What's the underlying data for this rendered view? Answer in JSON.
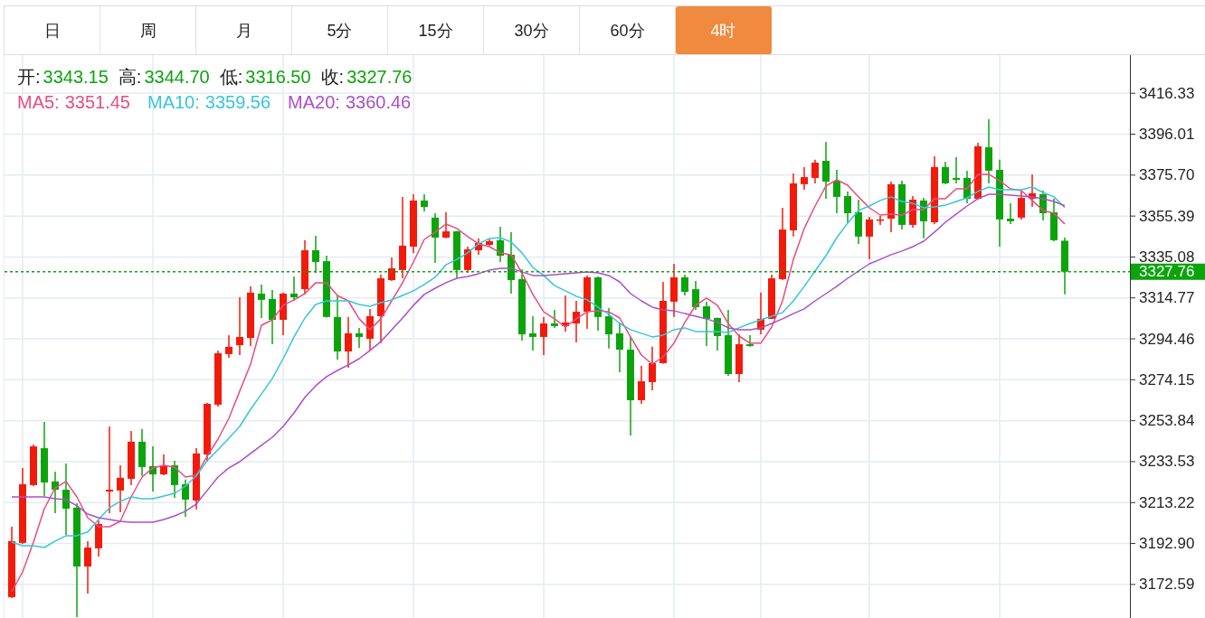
{
  "tabs": [
    {
      "label": "日",
      "selected": false
    },
    {
      "label": "周",
      "selected": false
    },
    {
      "label": "月",
      "selected": false
    },
    {
      "label": "5分",
      "selected": false
    },
    {
      "label": "15分",
      "selected": false
    },
    {
      "label": "30分",
      "selected": false
    },
    {
      "label": "60分",
      "selected": false
    },
    {
      "label": "4时",
      "selected": true
    }
  ],
  "chart": {
    "ohlc_legend": [
      {
        "label": "开:",
        "value": "3343.15"
      },
      {
        "label": "高:",
        "value": "3344.70"
      },
      {
        "label": "低:",
        "value": "3316.50"
      },
      {
        "label": "收:",
        "value": "3327.76"
      }
    ],
    "ma_readings": [
      "3351.45",
      "3359.56",
      "3360.46"
    ],
    "chart_data": {
      "type": "candlestick",
      "grid": true,
      "ylim": [
        3155.94,
        3435.25
      ],
      "yticks": [
        {
          "value": 3416.33,
          "label": "3416.33"
        },
        {
          "value": 3396.01,
          "label": "3396.01"
        },
        {
          "value": 3375.7,
          "label": "3375.70"
        },
        {
          "value": 3355.39,
          "label": "3355.39"
        },
        {
          "value": 3335.08,
          "label": "3335.08"
        },
        {
          "value": 3314.77,
          "label": "3314.77"
        },
        {
          "value": 3294.46,
          "label": "3294.46"
        },
        {
          "value": 3274.15,
          "label": "3274.15"
        },
        {
          "value": 3253.84,
          "label": "3253.84"
        },
        {
          "value": 3233.53,
          "label": "3233.53"
        },
        {
          "value": 3213.22,
          "label": "3213.22"
        },
        {
          "value": 3192.9,
          "label": "3192.90"
        },
        {
          "value": 3172.59,
          "label": "3172.59"
        }
      ],
      "ohlc": [
        [
          3166.3,
          3201.2,
          3165.8,
          3194.1
        ],
        [
          3193.2,
          3230.4,
          3192.7,
          3222.3
        ],
        [
          3221.9,
          3242.0,
          3221.4,
          3241.1
        ],
        [
          3240.2,
          3253.2,
          3216.5,
          3223.2
        ],
        [
          3223.7,
          3228.6,
          3208.0,
          3219.6
        ],
        [
          3219.6,
          3232.6,
          3197.2,
          3210.2
        ],
        [
          3210.7,
          3212.9,
          3156.4,
          3181.5
        ],
        [
          3181.5,
          3194.1,
          3168.1,
          3190.9
        ],
        [
          3190.5,
          3204.4,
          3186.4,
          3202.6
        ],
        [
          3218.7,
          3251.0,
          3208.0,
          3219.6
        ],
        [
          3219.2,
          3231.7,
          3208.4,
          3225.5
        ],
        [
          3225.0,
          3248.8,
          3221.9,
          3243.4
        ],
        [
          3243.4,
          3249.7,
          3226.4,
          3230.8
        ],
        [
          3231.3,
          3241.1,
          3218.7,
          3227.2
        ],
        [
          3227.2,
          3237.1,
          3226.8,
          3231.7
        ],
        [
          3231.7,
          3234.0,
          3215.6,
          3221.9
        ],
        [
          3222.3,
          3224.6,
          3206.2,
          3214.7
        ],
        [
          3214.2,
          3240.2,
          3209.8,
          3237.6
        ],
        [
          3237.1,
          3262.7,
          3233.5,
          3262.2
        ],
        [
          3261.8,
          3288.7,
          3260.9,
          3287.3
        ],
        [
          3286.9,
          3296.3,
          3285.1,
          3290.5
        ],
        [
          3291.3,
          3315.1,
          3286.4,
          3295.4
        ],
        [
          3294.9,
          3320.5,
          3290.9,
          3317.4
        ],
        [
          3316.9,
          3321.4,
          3304.8,
          3313.8
        ],
        [
          3314.2,
          3318.7,
          3291.8,
          3303.9
        ],
        [
          3303.9,
          3317.4,
          3296.3,
          3316.9
        ],
        [
          3316.9,
          3325.4,
          3313.3,
          3315.1
        ],
        [
          3319.1,
          3343.4,
          3316.5,
          3338.4
        ],
        [
          3338.4,
          3345.6,
          3327.2,
          3332.6
        ],
        [
          3333.0,
          3335.7,
          3305.0,
          3305.3
        ],
        [
          3305.3,
          3316.0,
          3284.2,
          3288.2
        ],
        [
          3288.2,
          3305.3,
          3280.1,
          3297.2
        ],
        [
          3297.2,
          3299.9,
          3290.0,
          3295.4
        ],
        [
          3294.5,
          3309.3,
          3288.7,
          3305.7
        ],
        [
          3305.7,
          3326.3,
          3292.3,
          3324.5
        ],
        [
          3323.6,
          3334.8,
          3323.2,
          3329.5
        ],
        [
          3328.6,
          3364.9,
          3324.5,
          3340.7
        ],
        [
          3340.2,
          3366.2,
          3337.1,
          3363.1
        ],
        [
          3363.1,
          3366.2,
          3357.7,
          3359.9
        ],
        [
          3354.6,
          3356.8,
          3332.1,
          3344.7
        ],
        [
          3344.7,
          3357.3,
          3344.3,
          3347.8
        ],
        [
          3347.8,
          3348.0,
          3324.5,
          3328.6
        ],
        [
          3328.6,
          3340.2,
          3327.2,
          3338.9
        ],
        [
          3338.4,
          3344.3,
          3336.2,
          3342.0
        ],
        [
          3341.1,
          3343.8,
          3340.7,
          3342.9
        ],
        [
          3343.4,
          3350.1,
          3332.6,
          3335.7
        ],
        [
          3336.2,
          3347.4,
          3316.9,
          3323.6
        ],
        [
          3324.1,
          3329.0,
          3293.6,
          3296.7
        ],
        [
          3297.2,
          3305.7,
          3288.7,
          3295.4
        ],
        [
          3295.4,
          3305.3,
          3286.4,
          3302.1
        ],
        [
          3302.1,
          3308.8,
          3299.9,
          3300.8
        ],
        [
          3300.8,
          3316.0,
          3298.1,
          3302.6
        ],
        [
          3302.1,
          3313.3,
          3292.7,
          3307.9
        ],
        [
          3307.9,
          3325.9,
          3299.4,
          3325.0
        ],
        [
          3325.0,
          3325.4,
          3298.5,
          3305.3
        ],
        [
          3305.7,
          3309.7,
          3289.6,
          3296.7
        ],
        [
          3297.2,
          3302.6,
          3277.9,
          3289.1
        ],
        [
          3289.1,
          3295.4,
          3246.5,
          3264.0
        ],
        [
          3264.0,
          3281.0,
          3262.2,
          3273.4
        ],
        [
          3273.0,
          3290.5,
          3268.9,
          3282.4
        ],
        [
          3282.4,
          3322.7,
          3282.2,
          3313.3
        ],
        [
          3312.9,
          3331.7,
          3305.3,
          3325.0
        ],
        [
          3325.0,
          3326.3,
          3316.0,
          3317.8
        ],
        [
          3319.1,
          3323.2,
          3308.8,
          3310.2
        ],
        [
          3310.6,
          3312.9,
          3290.9,
          3304.4
        ],
        [
          3304.8,
          3305.0,
          3288.7,
          3295.8
        ],
        [
          3296.3,
          3308.8,
          3276.1,
          3277.0
        ],
        [
          3277.0,
          3296.7,
          3273.0,
          3291.8
        ],
        [
          3291.8,
          3296.3,
          3290.5,
          3290.9
        ],
        [
          3299.0,
          3317.4,
          3296.7,
          3304.4
        ],
        [
          3304.4,
          3326.3,
          3304.2,
          3324.5
        ],
        [
          3324.1,
          3359.5,
          3323.6,
          3348.7
        ],
        [
          3348.3,
          3376.5,
          3345.2,
          3371.6
        ],
        [
          3371.2,
          3379.7,
          3368.5,
          3374.7
        ],
        [
          3374.3,
          3383.3,
          3371.6,
          3381.9
        ],
        [
          3382.8,
          3392.2,
          3364.0,
          3372.5
        ],
        [
          3372.9,
          3378.3,
          3356.8,
          3364.9
        ],
        [
          3365.3,
          3367.6,
          3351.9,
          3356.8
        ],
        [
          3357.3,
          3363.5,
          3341.6,
          3345.2
        ],
        [
          3345.2,
          3355.0,
          3333.9,
          3353.7
        ],
        [
          3353.2,
          3355.5,
          3351.0,
          3353.7
        ],
        [
          3354.1,
          3372.5,
          3347.4,
          3371.2
        ],
        [
          3371.2,
          3372.9,
          3348.7,
          3351.0
        ],
        [
          3351.0,
          3365.3,
          3349.6,
          3363.5
        ],
        [
          3363.1,
          3364.4,
          3344.3,
          3352.8
        ],
        [
          3352.3,
          3385.0,
          3351.4,
          3379.7
        ],
        [
          3379.7,
          3382.4,
          3371.2,
          3371.6
        ],
        [
          3374.3,
          3384.6,
          3371.6,
          3373.4
        ],
        [
          3374.3,
          3377.9,
          3361.7,
          3364.0
        ],
        [
          3364.0,
          3391.8,
          3363.5,
          3390.0
        ],
        [
          3389.5,
          3403.4,
          3371.6,
          3377.9
        ],
        [
          3378.3,
          3383.3,
          3340.2,
          3353.7
        ],
        [
          3354.1,
          3361.7,
          3351.4,
          3352.8
        ],
        [
          3354.6,
          3367.6,
          3353.7,
          3364.4
        ],
        [
          3364.0,
          3376.1,
          3359.9,
          3366.7
        ],
        [
          3366.2,
          3368.0,
          3353.2,
          3356.8
        ],
        [
          3357.3,
          3364.0,
          3342.9,
          3343.4
        ],
        [
          3343.15,
          3344.7,
          3316.5,
          3327.76
        ]
      ],
      "series": [
        {
          "name": "MA5:",
          "type": "line",
          "color": "#ea4c82",
          "values": [
            3169.0,
            3178.8,
            3193.6,
            3210.2,
            3220.5,
            3223.7,
            3216.0,
            3205.7,
            3201.2,
            3201.2,
            3203.9,
            3216.0,
            3225.9,
            3230.4,
            3231.7,
            3230.8,
            3225.9,
            3226.8,
            3236.2,
            3244.7,
            3255.0,
            3268.5,
            3281.9,
            3301.2,
            3303.9,
            3311.1,
            3313.8,
            3316.9,
            3322.3,
            3322.3,
            3316.0,
            3313.3,
            3304.4,
            3299.0,
            3304.4,
            3313.3,
            3322.3,
            3332.6,
            3343.8,
            3347.4,
            3351.4,
            3349.2,
            3345.2,
            3341.6,
            3340.2,
            3337.1,
            3336.2,
            3327.2,
            3316.5,
            3307.9,
            3304.4,
            3300.3,
            3304.4,
            3307.9,
            3308.4,
            3307.9,
            3304.8,
            3295.4,
            3286.4,
            3281.9,
            3285.5,
            3292.3,
            3302.6,
            3311.1,
            3314.7,
            3311.1,
            3302.1,
            3295.8,
            3292.3,
            3292.3,
            3300.3,
            3313.3,
            3333.9,
            3349.2,
            3360.4,
            3370.3,
            3373.4,
            3370.7,
            3364.9,
            3359.5,
            3355.9,
            3356.4,
            3355.9,
            3358.6,
            3358.6,
            3364.0,
            3364.0,
            3368.9,
            3368.9,
            3376.1,
            3376.1,
            3372.9,
            3368.9,
            3368.0,
            3363.1,
            3358.2,
            3356.8,
            3351.45
          ]
        },
        {
          "name": "MA10:",
          "type": "line",
          "color": "#36c6da",
          "values": [
            3193.6,
            3191.8,
            3191.8,
            3190.9,
            3194.1,
            3196.8,
            3196.8,
            3198.6,
            3204.8,
            3210.7,
            3213.8,
            3216.0,
            3215.1,
            3215.1,
            3216.5,
            3217.8,
            3221.4,
            3226.4,
            3234.0,
            3239.4,
            3245.2,
            3251.0,
            3259.5,
            3267.1,
            3274.8,
            3284.6,
            3295.4,
            3304.8,
            3311.5,
            3313.3,
            3313.3,
            3313.3,
            3311.5,
            3310.6,
            3312.4,
            3313.8,
            3316.0,
            3318.3,
            3321.4,
            3325.0,
            3331.2,
            3333.9,
            3337.1,
            3341.6,
            3344.3,
            3344.7,
            3342.5,
            3337.1,
            3329.9,
            3325.9,
            3320.9,
            3318.3,
            3315.6,
            3313.8,
            3310.2,
            3306.6,
            3302.1,
            3299.0,
            3297.2,
            3295.4,
            3296.3,
            3299.0,
            3299.9,
            3298.1,
            3298.1,
            3298.1,
            3297.6,
            3299.9,
            3302.1,
            3303.9,
            3305.7,
            3307.5,
            3313.3,
            3320.5,
            3328.1,
            3335.7,
            3344.7,
            3351.9,
            3358.2,
            3360.4,
            3363.1,
            3364.9,
            3362.6,
            3361.7,
            3359.5,
            3359.9,
            3360.8,
            3362.6,
            3364.4,
            3367.6,
            3369.8,
            3368.5,
            3368.5,
            3368.5,
            3369.8,
            3367.1,
            3364.9,
            3359.56
          ]
        },
        {
          "name": "MA20:",
          "type": "line",
          "color": "#ab4fc6",
          "values": [
            3216.0,
            3216.0,
            3216.0,
            3216.0,
            3215.1,
            3214.7,
            3211.6,
            3207.5,
            3205.7,
            3204.8,
            3203.9,
            3203.5,
            3203.5,
            3203.5,
            3204.8,
            3206.6,
            3208.9,
            3212.5,
            3219.2,
            3225.9,
            3230.4,
            3233.5,
            3237.6,
            3241.6,
            3245.6,
            3251.0,
            3257.7,
            3265.4,
            3271.2,
            3275.7,
            3278.8,
            3281.5,
            3284.6,
            3288.7,
            3293.1,
            3299.0,
            3304.8,
            3311.1,
            3316.5,
            3319.6,
            3322.3,
            3324.5,
            3325.4,
            3326.8,
            3328.6,
            3329.5,
            3329.5,
            3327.7,
            3325.9,
            3325.9,
            3326.3,
            3326.8,
            3327.2,
            3327.7,
            3327.2,
            3325.9,
            3322.7,
            3316.9,
            3313.3,
            3310.2,
            3308.8,
            3308.4,
            3307.0,
            3305.7,
            3304.4,
            3302.6,
            3299.9,
            3299.0,
            3299.0,
            3299.9,
            3302.1,
            3304.4,
            3307.0,
            3309.3,
            3313.3,
            3316.9,
            3320.5,
            3324.5,
            3328.1,
            3331.7,
            3333.9,
            3336.2,
            3338.0,
            3340.2,
            3342.9,
            3347.4,
            3352.3,
            3356.4,
            3360.4,
            3364.0,
            3366.2,
            3366.2,
            3365.8,
            3365.3,
            3364.9,
            3364.0,
            3362.6,
            3360.46
          ]
        }
      ],
      "ref_lines": [
        {
          "axis": "y",
          "value": 3327.76,
          "label": "3327.76"
        }
      ]
    }
  }
}
